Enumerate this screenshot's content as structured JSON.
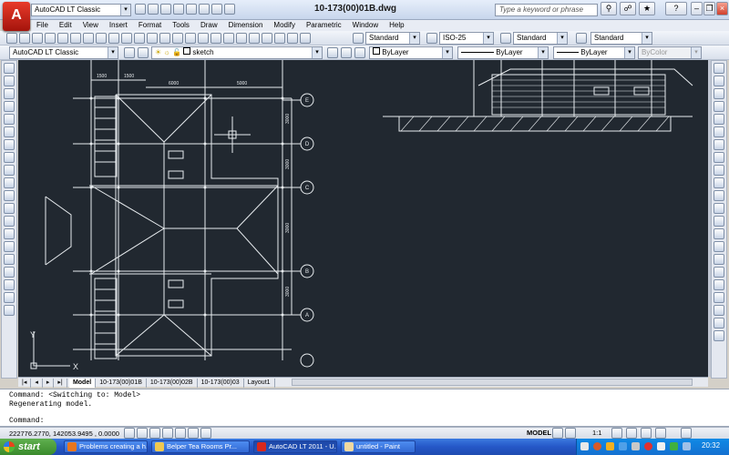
{
  "app": {
    "logo_letter": "A",
    "workspace": "AutoCAD LT Classic",
    "document_title": "10-173(00)01B.dwg",
    "search_placeholder": "Type a keyword or phrase",
    "help_label": "?"
  },
  "menu": [
    "File",
    "Edit",
    "View",
    "Insert",
    "Format",
    "Tools",
    "Draw",
    "Dimension",
    "Modify",
    "Parametric",
    "Window",
    "Help"
  ],
  "styles_toolbar": {
    "text_style": "Standard",
    "dim_style": "ISO-25",
    "table_style": "Standard",
    "mleader_style": "Standard"
  },
  "layers_toolbar": {
    "workspace": "AutoCAD LT Classic",
    "layer": "sketch",
    "color": "ByLayer",
    "linetype": "ByLayer",
    "lineweight": "ByLayer",
    "plotstyle": "ByColor"
  },
  "drawing": {
    "grid_labels": [
      "E",
      "D",
      "C",
      "B",
      "A"
    ],
    "dims_top": [
      "1500",
      "1500",
      "6000",
      "5000"
    ],
    "dims_side": [
      "3000",
      "3000",
      "3000",
      "3000"
    ],
    "ucs_y": "Y",
    "ucs_x": "X",
    "colors": {
      "background": "#212830",
      "lines": "#e8ecef",
      "ground": "#c8c8c8"
    }
  },
  "layout_tabs": [
    "Model",
    "10-173(00)01B",
    "10-173(00)02B",
    "10-173(00)03",
    "Layout1"
  ],
  "active_tab": "Model",
  "command_lines": [
    "Command:  <Switching to: Model>",
    "Regenerating model.",
    "Command:"
  ],
  "status": {
    "coordinates": "222776.2770, 142053.9495 , 0.0000",
    "model_label": "MODEL",
    "scale": "1:1"
  },
  "taskbar": {
    "start": "start",
    "tasks": [
      {
        "label": "Problems creating a h...",
        "color": "#e8761e"
      },
      {
        "label": "Belper Tea Rooms Pr...",
        "color": "#f0c850"
      },
      {
        "label": "AutoCAD LT 2011 - U...",
        "color": "#d8281c"
      },
      {
        "label": "untitled - Paint",
        "color": "#f0d8a0"
      }
    ],
    "clock": "20:32"
  }
}
